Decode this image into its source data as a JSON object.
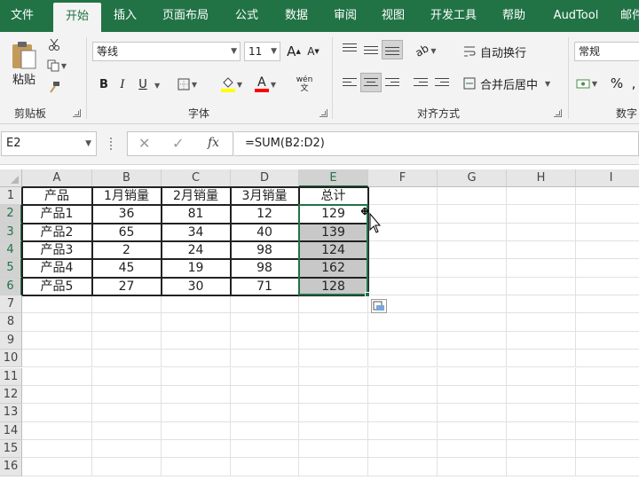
{
  "ribbon_tabs": [
    "文件",
    "开始",
    "插入",
    "页面布局",
    "公式",
    "数据",
    "审阅",
    "视图",
    "开发工具",
    "帮助",
    "AudTool",
    "邮件"
  ],
  "active_tab": "开始",
  "clipboard": {
    "paste_label": "粘贴",
    "group_label": "剪贴板"
  },
  "font": {
    "name": "等线",
    "size": "11",
    "bold": "B",
    "italic": "I",
    "underline": "U",
    "phonetic": "wén\n文",
    "group_label": "字体"
  },
  "alignment": {
    "wrap_text": "自动换行",
    "merge_center": "合并后居中",
    "group_label": "对齐方式"
  },
  "number": {
    "format": "常规",
    "percent": "%",
    "group_label": "数字"
  },
  "colors": {
    "accent": "#217346",
    "fill": "#ffff00",
    "font_color": "#ff0000"
  },
  "formula_bar": {
    "name_box": "E2",
    "formula": "=SUM(B2:D2)",
    "fx": "fx"
  },
  "sheet": {
    "columns": [
      "A",
      "B",
      "C",
      "D",
      "E",
      "F",
      "G",
      "H",
      "I"
    ],
    "rows": [
      "1",
      "2",
      "3",
      "4",
      "5",
      "6",
      "7",
      "8",
      "9",
      "10",
      "11",
      "12",
      "13",
      "14",
      "15",
      "16"
    ],
    "headers": [
      "产品",
      "1月销量",
      "2月销量",
      "3月销量",
      "总计"
    ],
    "data": [
      [
        "产品1",
        "36",
        "81",
        "12",
        "129"
      ],
      [
        "产品2",
        "65",
        "34",
        "40",
        "139"
      ],
      [
        "产品3",
        "2",
        "24",
        "98",
        "124"
      ],
      [
        "产品4",
        "45",
        "19",
        "98",
        "162"
      ],
      [
        "产品5",
        "27",
        "30",
        "71",
        "128"
      ]
    ],
    "active_cell": "E2",
    "selection": "E2:E6"
  }
}
